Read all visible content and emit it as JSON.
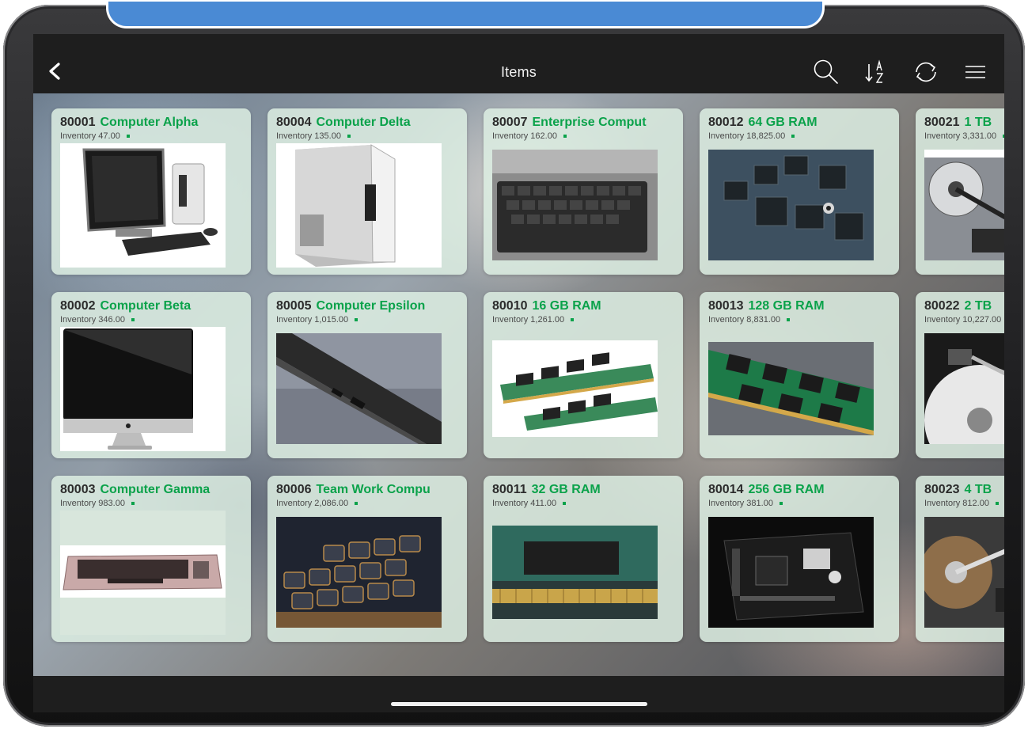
{
  "navbar": {
    "title": "Items",
    "icons": [
      "back-icon",
      "search-icon",
      "sort-az-icon",
      "sync-icon",
      "menu-icon"
    ]
  },
  "items": [
    {
      "id": "80001",
      "name": "Computer Alpha",
      "inventory": "Inventory 47.00",
      "image": "desktop-computer-image"
    },
    {
      "id": "80002",
      "name": "Computer Beta",
      "inventory": "Inventory 346.00",
      "image": "monitor-image"
    },
    {
      "id": "80003",
      "name": "Computer Gamma",
      "inventory": "Inventory 983.00",
      "image": "retro-keyboard-image"
    },
    {
      "id": "80004",
      "name": "Computer Delta",
      "inventory": "Inventory 135.00",
      "image": "tower-pc-image"
    },
    {
      "id": "80005",
      "name": "Computer Epsilon",
      "inventory": "Inventory 1,015.00",
      "image": "laptop-edge-image"
    },
    {
      "id": "80006",
      "name": "Team Work Compu",
      "inventory": "Inventory 2,086.00",
      "image": "backlit-keyboard-image"
    },
    {
      "id": "80007",
      "name": "Enterprise Comput",
      "inventory": "Inventory 162.00",
      "image": "laptop-keyboard-image"
    },
    {
      "id": "80010",
      "name": "16 GB RAM",
      "inventory": "Inventory 1,261.00",
      "image": "ram-sticks-image"
    },
    {
      "id": "80011",
      "name": "32 GB RAM",
      "inventory": "Inventory 411.00",
      "image": "ram-closeup-image"
    },
    {
      "id": "80012",
      "name": "64 GB RAM",
      "inventory": "Inventory 18,825.00",
      "image": "circuit-board-image"
    },
    {
      "id": "80013",
      "name": "128 GB RAM",
      "inventory": "Inventory 8,831.00",
      "image": "green-ram-image"
    },
    {
      "id": "80014",
      "name": "256 GB RAM",
      "inventory": "Inventory 381.00",
      "image": "motherboard-image"
    },
    {
      "id": "80021",
      "name": "1 TB",
      "inventory": "Inventory 3,331.00",
      "image": "hard-drive-image"
    },
    {
      "id": "80022",
      "name": "2 TB",
      "inventory": "Inventory 10,227.00",
      "image": "hard-drive-platter-image"
    },
    {
      "id": "80023",
      "name": "4 TB",
      "inventory": "Inventory 812.00",
      "image": "hard-drive-head-image"
    }
  ],
  "colors": {
    "accent_green": "#0aa24a",
    "card_bg": "#dceee2",
    "navbar_bg": "#1e1e1e",
    "tab_blue": "#4a8ad4"
  }
}
